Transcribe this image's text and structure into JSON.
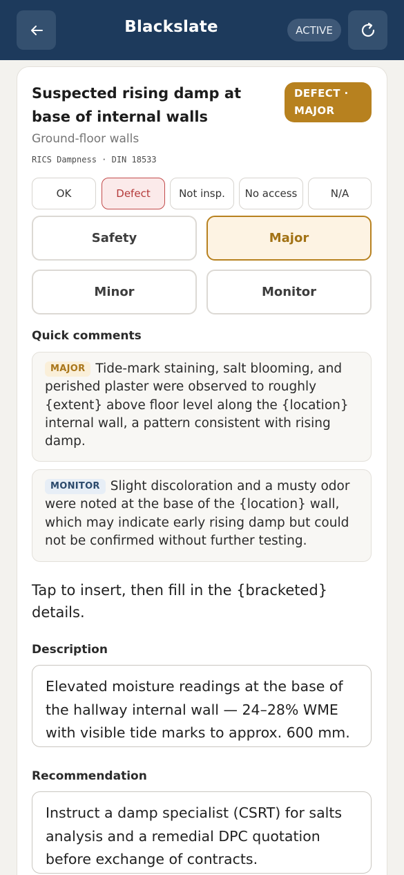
{
  "header": {
    "back_icon": "arrow-left-icon",
    "title": "Blackslate",
    "status": "ACTIVE",
    "refresh_icon": "refresh-icon"
  },
  "item": {
    "title": "Suspected rising damp at base of internal walls",
    "severity_badge": "DEFECT · MAJOR",
    "location": "Ground-floor walls",
    "standards": "RICS Dampness · DIN 18533"
  },
  "status_options": [
    {
      "label": "OK",
      "selected": false
    },
    {
      "label": "Defect",
      "selected": true
    },
    {
      "label": "Not insp.",
      "selected": false
    },
    {
      "label": "No access",
      "selected": false
    },
    {
      "label": "N/A",
      "selected": false
    }
  ],
  "severity_options": [
    {
      "label": "Safety",
      "selected": false
    },
    {
      "label": "Major",
      "selected": true
    },
    {
      "label": "Minor",
      "selected": false
    },
    {
      "label": "Monitor",
      "selected": false
    }
  ],
  "quick_comments": {
    "label": "Quick comments",
    "items": [
      {
        "tag": "MAJOR",
        "text": "Tide-mark staining, salt blooming, and perished plaster were observed to roughly {extent} above floor level along the {location} internal wall, a pattern consistent with rising damp."
      },
      {
        "tag": "MONITOR",
        "text": "Slight discoloration and a musty odor were noted at the base of the {location} wall, which may indicate early rising damp but could not be confirmed without further testing."
      }
    ],
    "hint": "Tap to insert, then fill in the {bracketed} details."
  },
  "description": {
    "label": "Description",
    "value": "Elevated moisture readings at the base of the hallway internal wall — 24–28% WME with visible tide marks to approx. 600 mm."
  },
  "recommendation": {
    "label": "Recommendation",
    "value": "Instruct a damp specialist (CSRT) for salts analysis and a remedial DPC quotation before exchange of contracts."
  },
  "colors": {
    "header_bg": "#1d3a5c",
    "major_accent": "#b7811f",
    "defect_accent": "#c24a4a"
  }
}
